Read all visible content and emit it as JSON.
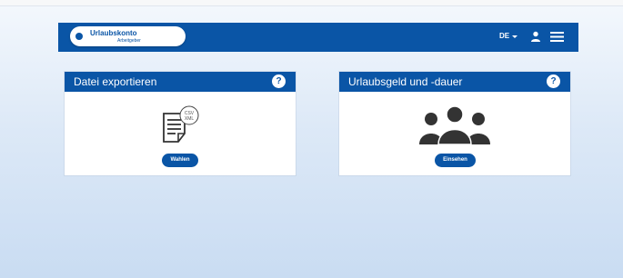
{
  "header": {
    "logo_title": "Urlaubskonto",
    "logo_subtitle": "Arbeitgeber",
    "language": "DE",
    "icons": [
      "user-icon",
      "menu-icon"
    ],
    "accent_color": "#0a55a6"
  },
  "cards": [
    {
      "title": "Datei exportieren",
      "help_symbol": "?",
      "badge_lines": [
        "CSV",
        "XML"
      ],
      "icon": "document-export-icon",
      "button_label": "Wahlen"
    },
    {
      "title": "Urlaubsgeld und -dauer",
      "help_symbol": "?",
      "icon": "group-icon",
      "button_label": "Einsehen"
    }
  ]
}
